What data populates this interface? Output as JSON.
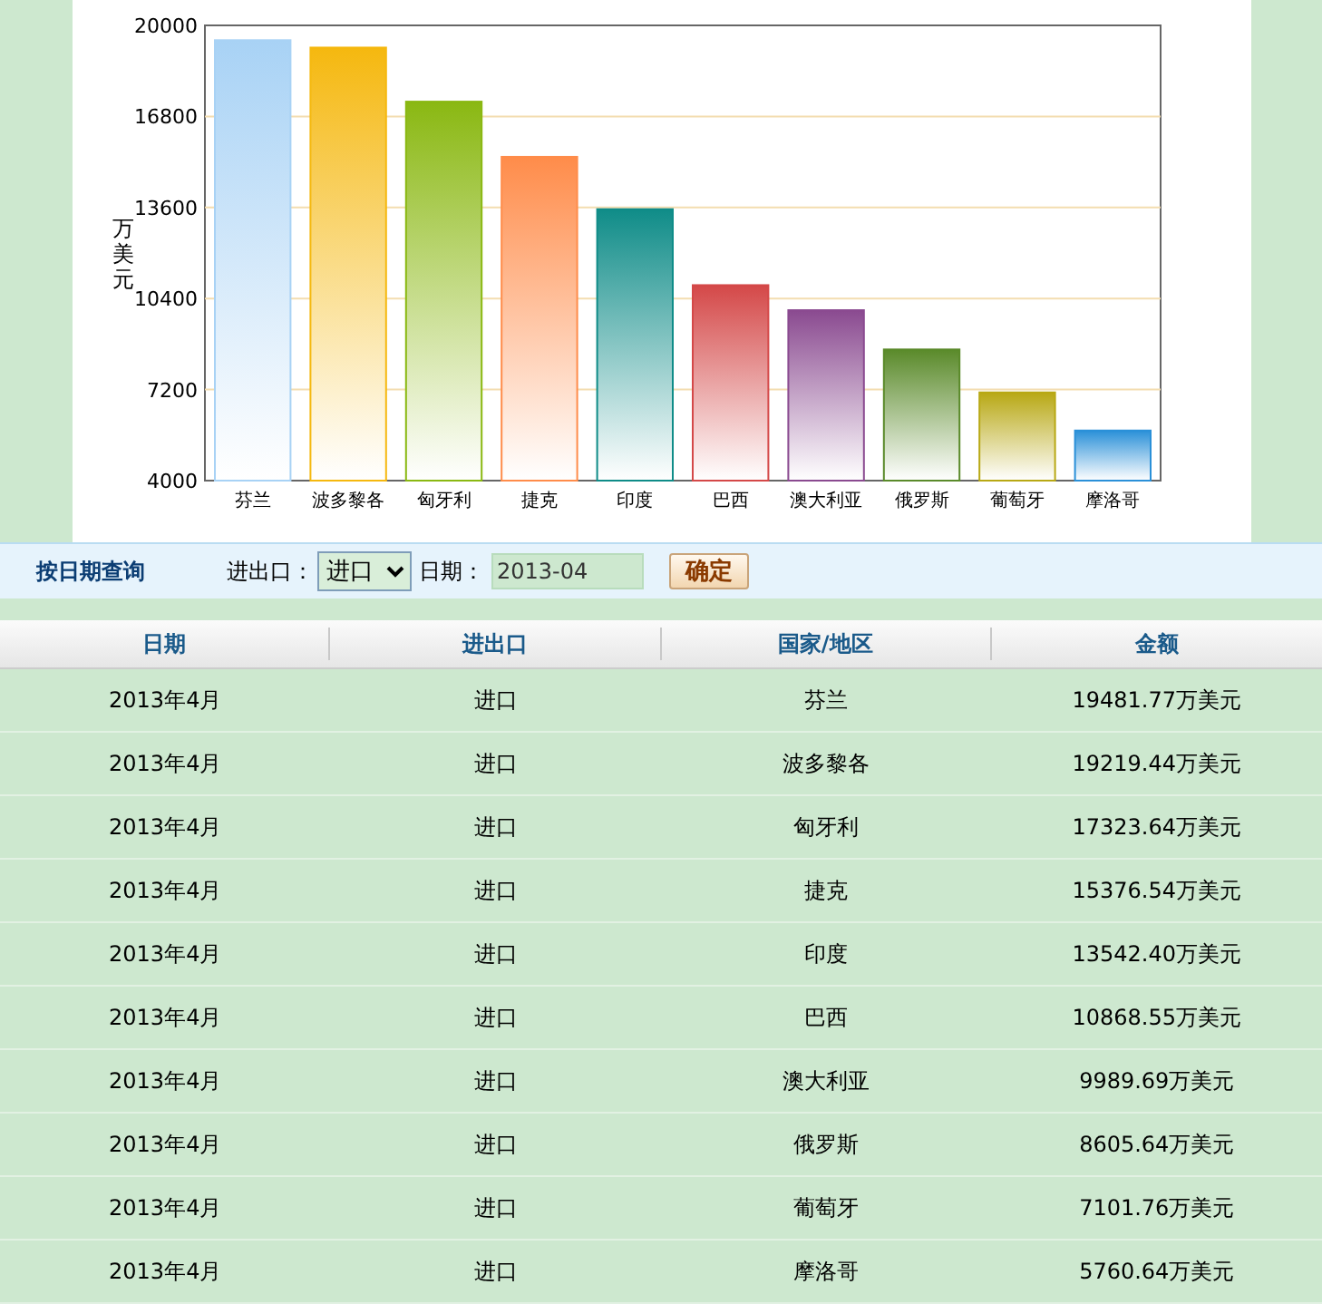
{
  "chart_data": {
    "type": "bar",
    "ylabel": "万美元",
    "categories": [
      "芬兰",
      "波多黎各",
      "匈牙利",
      "捷克",
      "印度",
      "巴西",
      "澳大利亚",
      "俄罗斯",
      "葡萄牙",
      "摩洛哥"
    ],
    "grid": true,
    "series": [
      {
        "color": "#a8d2f5",
        "values": [
          19480,
          null,
          null,
          null,
          null,
          null,
          null,
          null,
          null,
          null
        ]
      },
      {
        "color": "#f5b80f",
        "values": [
          null,
          19220,
          null,
          null,
          null,
          null,
          null,
          null,
          null,
          null
        ]
      },
      {
        "color": "#8ab812",
        "values": [
          null,
          null,
          17320,
          null,
          null,
          null,
          null,
          null,
          null,
          null
        ]
      },
      {
        "color": "#ff8c4a",
        "values": [
          null,
          null,
          null,
          15380,
          null,
          null,
          null,
          null,
          null,
          null
        ]
      },
      {
        "color": "#0f8c88",
        "values": [
          null,
          null,
          null,
          null,
          13540,
          null,
          null,
          null,
          null,
          null
        ]
      },
      {
        "color": "#d44848",
        "values": [
          null,
          null,
          null,
          null,
          null,
          10870,
          null,
          null,
          null,
          null
        ]
      },
      {
        "color": "#8a4a90",
        "values": [
          null,
          null,
          null,
          null,
          null,
          null,
          9990,
          null,
          null,
          null
        ]
      },
      {
        "color": "#5a8a2a",
        "values": [
          null,
          null,
          null,
          null,
          null,
          null,
          null,
          8610,
          null,
          null
        ]
      },
      {
        "color": "#b8a814",
        "values": [
          null,
          null,
          null,
          null,
          null,
          null,
          null,
          null,
          7100,
          null
        ]
      },
      {
        "color": "#2a90d8",
        "values": [
          null,
          null,
          null,
          null,
          null,
          null,
          null,
          null,
          null,
          5760
        ]
      }
    ],
    "ylim": [
      4000,
      20000
    ],
    "yticks": [
      4000,
      7200,
      10400,
      13600,
      16800,
      20000
    ]
  },
  "query": {
    "title": "按日期查询",
    "direction_label": "进出口：",
    "direction_value": "进口",
    "date_label": "日期：",
    "date_value": "2013-04",
    "submit": "确定"
  },
  "table": {
    "columns": [
      "日期",
      "进出口",
      "国家/地区",
      "金额"
    ],
    "rows": [
      [
        "2013年4月",
        "进口",
        "芬兰",
        "19481.77万美元"
      ],
      [
        "2013年4月",
        "进口",
        "波多黎各",
        "19219.44万美元"
      ],
      [
        "2013年4月",
        "进口",
        "匈牙利",
        "17323.64万美元"
      ],
      [
        "2013年4月",
        "进口",
        "捷克",
        "15376.54万美元"
      ],
      [
        "2013年4月",
        "进口",
        "印度",
        "13542.40万美元"
      ],
      [
        "2013年4月",
        "进口",
        "巴西",
        "10868.55万美元"
      ],
      [
        "2013年4月",
        "进口",
        "澳大利亚",
        "9989.69万美元"
      ],
      [
        "2013年4月",
        "进口",
        "俄罗斯",
        "8605.64万美元"
      ],
      [
        "2013年4月",
        "进口",
        "葡萄牙",
        "7101.76万美元"
      ],
      [
        "2013年4月",
        "进口",
        "摩洛哥",
        "5760.64万美元"
      ]
    ]
  }
}
